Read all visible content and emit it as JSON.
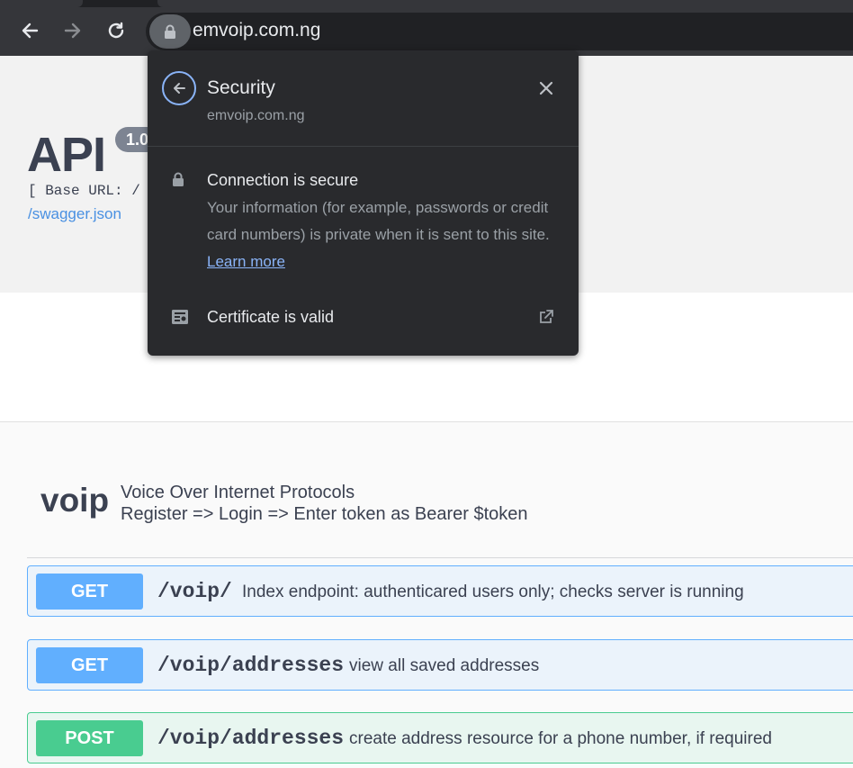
{
  "browser": {
    "url": "emvoip.com.ng",
    "icons": [
      "back-arrow-icon",
      "forward-arrow-icon",
      "reload-icon",
      "lock-icon"
    ]
  },
  "page": {
    "title": "API",
    "version": "1.0",
    "base_url": "[ Base URL: /",
    "swagger_link": "/swagger.json"
  },
  "tag": {
    "name": "voip",
    "description_line1": "Voice Over Internet Protocols",
    "description_line2": "Register => Login => Enter token as Bearer $token"
  },
  "operations": [
    {
      "method": "GET",
      "path": "/voip/",
      "summary": "Index endpoint: authenticared users only; checks server is running"
    },
    {
      "method": "GET",
      "path": "/voip/addresses",
      "summary": "view all saved addresses"
    },
    {
      "method": "POST",
      "path": "/voip/addresses",
      "summary": "create address resource for a phone number, if required"
    }
  ],
  "security_popup": {
    "title": "Security",
    "site": "emvoip.com.ng",
    "connection_title": "Connection is secure",
    "connection_body": "Your information (for example, passwords or credit card numbers) is private when it is sent to this site.",
    "learn_more": "Learn more",
    "certificate": "Certificate is valid"
  },
  "colors": {
    "get": "#61affe",
    "post": "#49cc90",
    "popup_bg": "#292a2d",
    "link": "#8ab4f8"
  }
}
